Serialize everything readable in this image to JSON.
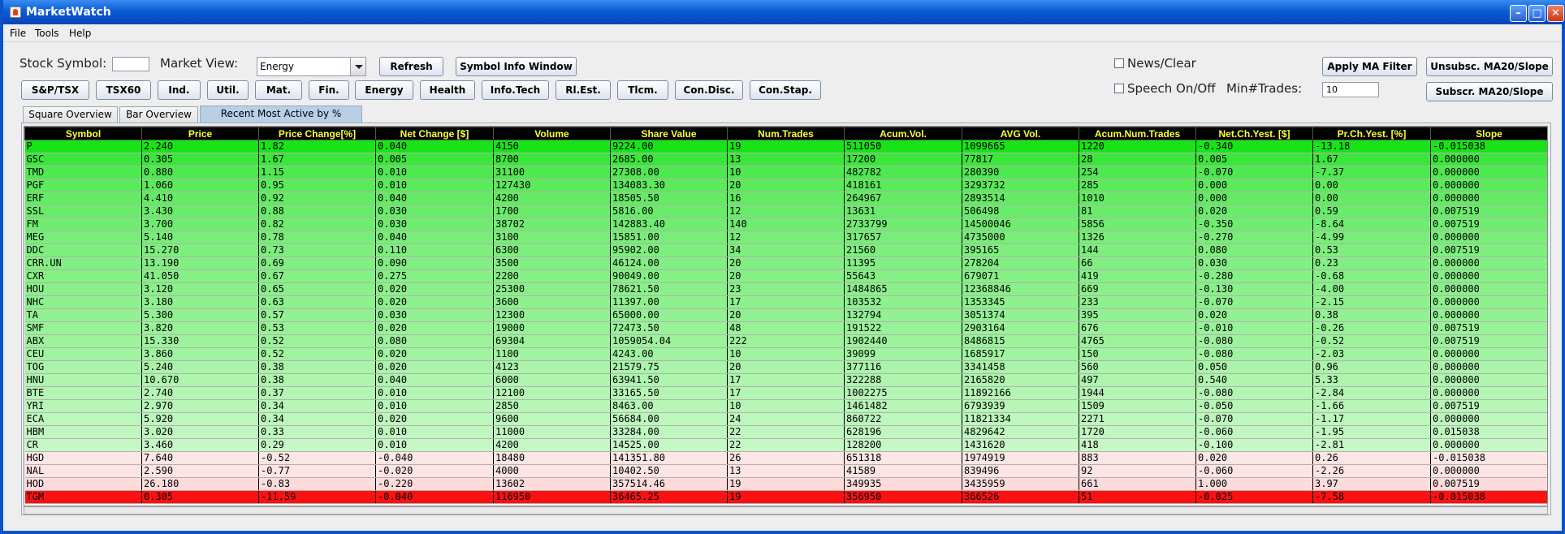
{
  "window": {
    "title": "MarketWatch",
    "icon": "java-cup-icon"
  },
  "menu": [
    "File",
    "Tools",
    "Help"
  ],
  "controls": {
    "stock_symbol_label": "Stock Symbol:",
    "stock_symbol_value": "",
    "market_view_label": "Market View:",
    "market_view_value": "Energy",
    "refresh": "Refresh",
    "symbol_info_window": "Symbol Info Window",
    "news_clear": "News/Clear",
    "speech_on_off": "Speech On/Off",
    "min_trades_label": "Min#Trades:",
    "min_trades_value": "10",
    "apply_ma_filter": "Apply MA Filter",
    "unsubsc_ma": "Unsubsc. MA20/Slope",
    "subscr_ma": "Subscr. MA20/Slope"
  },
  "sector_buttons": [
    "S&P/TSX",
    "TSX60",
    "Ind.",
    "Util.",
    "Mat.",
    "Fin.",
    "Energy",
    "Health",
    "Info.Tech",
    "Rl.Est.",
    "Tlcm.",
    "Con.Disc.",
    "Con.Stap."
  ],
  "tabs": [
    "Square Overview",
    "Bar Overview",
    "Recent Most Active by % Change"
  ],
  "active_tab": 2,
  "colors": {
    "header_bg": "#000000",
    "header_fg": "#ffff33",
    "loss_top": "#ff1010",
    "loss_light": "#ffe4e4",
    "gain_top": "#10e010",
    "gain_light": "#ccf8cc"
  },
  "table": {
    "columns": [
      "Symbol",
      "Price",
      "Price Change[%]",
      "Net Change [$]",
      "Volume",
      "Share Value",
      "Num.Trades",
      "Acum.Vol.",
      "AVG Vol.",
      "Acum.Num.Trades",
      "Net.Ch.Yest. [$]",
      "Pr.Ch.Yest. [%]",
      "Slope"
    ],
    "rows": [
      [
        "P",
        "2.240",
        "1.82",
        "0.040",
        "4150",
        "9224.00",
        "19",
        "511050",
        "1099665",
        "1220",
        "-0.340",
        "-13.18",
        "-0.015038"
      ],
      [
        "GSC",
        "0.305",
        "1.67",
        "0.005",
        "8700",
        "2685.00",
        "13",
        "17200",
        "77817",
        "28",
        "0.005",
        "1.67",
        "0.000000"
      ],
      [
        "TMD",
        "0.880",
        "1.15",
        "0.010",
        "31100",
        "27308.00",
        "10",
        "482782",
        "280390",
        "254",
        "-0.070",
        "-7.37",
        "0.000000"
      ],
      [
        "PGF",
        "1.060",
        "0.95",
        "0.010",
        "127430",
        "134083.30",
        "20",
        "418161",
        "3293732",
        "285",
        "0.000",
        "0.00",
        "0.000000"
      ],
      [
        "ERF",
        "4.410",
        "0.92",
        "0.040",
        "4200",
        "18505.50",
        "16",
        "264967",
        "2893514",
        "1010",
        "0.000",
        "0.00",
        "0.000000"
      ],
      [
        "SSL",
        "3.430",
        "0.88",
        "0.030",
        "1700",
        "5816.00",
        "12",
        "13631",
        "506498",
        "81",
        "0.020",
        "0.59",
        "0.007519"
      ],
      [
        "FM",
        "3.700",
        "0.82",
        "0.030",
        "38702",
        "142883.40",
        "140",
        "2733799",
        "14500046",
        "5856",
        "-0.350",
        "-8.64",
        "0.007519"
      ],
      [
        "MEG",
        "5.140",
        "0.78",
        "0.040",
        "3100",
        "15851.00",
        "12",
        "317657",
        "4735000",
        "1326",
        "-0.270",
        "-4.99",
        "0.000000"
      ],
      [
        "DDC",
        "15.270",
        "0.73",
        "0.110",
        "6300",
        "95902.00",
        "34",
        "21560",
        "395165",
        "144",
        "0.080",
        "0.53",
        "0.007519"
      ],
      [
        "CRR.UN",
        "13.190",
        "0.69",
        "0.090",
        "3500",
        "46124.00",
        "20",
        "11395",
        "278204",
        "66",
        "0.030",
        "0.23",
        "0.000000"
      ],
      [
        "CXR",
        "41.050",
        "0.67",
        "0.275",
        "2200",
        "90049.00",
        "20",
        "55643",
        "679071",
        "419",
        "-0.280",
        "-0.68",
        "0.000000"
      ],
      [
        "HOU",
        "3.120",
        "0.65",
        "0.020",
        "25300",
        "78621.50",
        "23",
        "1484865",
        "12368846",
        "669",
        "-0.130",
        "-4.00",
        "0.000000"
      ],
      [
        "NHC",
        "3.180",
        "0.63",
        "0.020",
        "3600",
        "11397.00",
        "17",
        "103532",
        "1353345",
        "233",
        "-0.070",
        "-2.15",
        "0.000000"
      ],
      [
        "TA",
        "5.300",
        "0.57",
        "0.030",
        "12300",
        "65000.00",
        "20",
        "132794",
        "3051374",
        "395",
        "0.020",
        "0.38",
        "0.000000"
      ],
      [
        "SMF",
        "3.820",
        "0.53",
        "0.020",
        "19000",
        "72473.50",
        "48",
        "191522",
        "2903164",
        "676",
        "-0.010",
        "-0.26",
        "0.007519"
      ],
      [
        "ABX",
        "15.330",
        "0.52",
        "0.080",
        "69304",
        "1059054.04",
        "222",
        "1902440",
        "8486815",
        "4765",
        "-0.080",
        "-0.52",
        "0.007519"
      ],
      [
        "CEU",
        "3.860",
        "0.52",
        "0.020",
        "1100",
        "4243.00",
        "10",
        "39099",
        "1685917",
        "150",
        "-0.080",
        "-2.03",
        "0.000000"
      ],
      [
        "TOG",
        "5.240",
        "0.38",
        "0.020",
        "4123",
        "21579.75",
        "20",
        "377116",
        "3341458",
        "560",
        "0.050",
        "0.96",
        "0.000000"
      ],
      [
        "HNU",
        "10.670",
        "0.38",
        "0.040",
        "6000",
        "63941.50",
        "17",
        "322288",
        "2165820",
        "497",
        "0.540",
        "5.33",
        "0.000000"
      ],
      [
        "BTE",
        "2.740",
        "0.37",
        "0.010",
        "12100",
        "33165.50",
        "17",
        "1002275",
        "11892166",
        "1944",
        "-0.080",
        "-2.84",
        "0.000000"
      ],
      [
        "YRI",
        "2.970",
        "0.34",
        "0.010",
        "2850",
        "8463.00",
        "10",
        "1461482",
        "6793939",
        "1509",
        "-0.050",
        "-1.66",
        "0.007519"
      ],
      [
        "ECA",
        "5.920",
        "0.34",
        "0.020",
        "9600",
        "56684.00",
        "24",
        "860722",
        "11821334",
        "2271",
        "-0.070",
        "-1.17",
        "0.000000"
      ],
      [
        "HBM",
        "3.020",
        "0.33",
        "0.010",
        "11000",
        "33284.00",
        "22",
        "628196",
        "4829642",
        "1720",
        "-0.060",
        "-1.95",
        "0.015038"
      ],
      [
        "CR",
        "3.460",
        "0.29",
        "0.010",
        "4200",
        "14525.00",
        "22",
        "128200",
        "1431620",
        "418",
        "-0.100",
        "-2.81",
        "0.000000"
      ],
      [
        "HGD",
        "7.640",
        "-0.52",
        "-0.040",
        "18480",
        "141351.80",
        "26",
        "651318",
        "1974919",
        "883",
        "0.020",
        "0.26",
        "-0.015038"
      ],
      [
        "NAL",
        "2.590",
        "-0.77",
        "-0.020",
        "4000",
        "10402.50",
        "13",
        "41589",
        "839496",
        "92",
        "-0.060",
        "-2.26",
        "0.000000"
      ],
      [
        "HOD",
        "26.180",
        "-0.83",
        "-0.220",
        "13602",
        "357514.46",
        "19",
        "349935",
        "3435959",
        "661",
        "1.000",
        "3.97",
        "0.007519"
      ],
      [
        "TGM",
        "0.305",
        "-11.59",
        "-0.040",
        "116950",
        "36465.25",
        "19",
        "356950",
        "366526",
        "51",
        "-0.025",
        "-7.58",
        "-0.015038"
      ]
    ],
    "row_colors": [
      "#17e317",
      "#3be63b",
      "#4ee94e",
      "#5aea5a",
      "#63eb63",
      "#69ec69",
      "#70ed70",
      "#78ee78",
      "#7eef7e",
      "#82ef82",
      "#86f086",
      "#8af08a",
      "#8ef18e",
      "#92f192",
      "#98f298",
      "#9cf39c",
      "#a0f3a0",
      "#a9f4a9",
      "#aef5ae",
      "#b3f6b3",
      "#b8f6b8",
      "#bcf7bc",
      "#c0f7c0",
      "#c6f8c6",
      "#ffe6e6",
      "#ffe4e4",
      "#ffdcdc",
      "#ff1010"
    ]
  }
}
